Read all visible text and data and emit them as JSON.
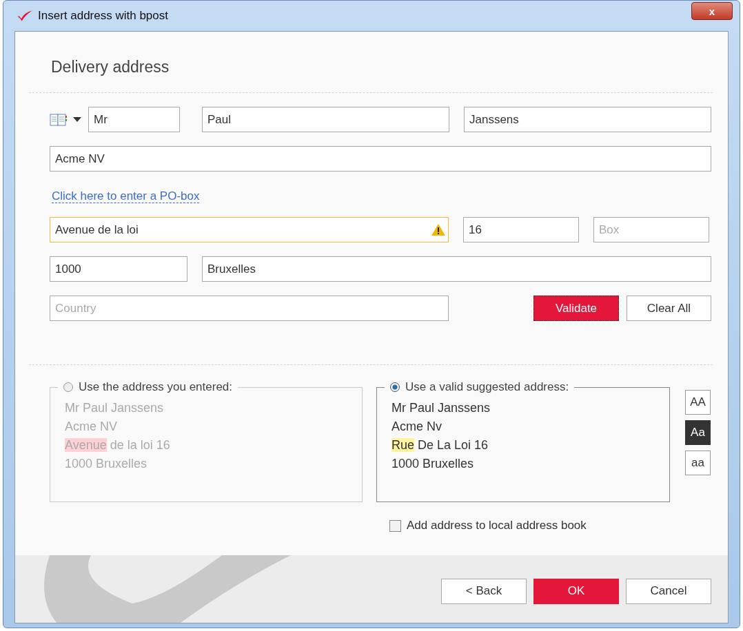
{
  "window": {
    "title": "Insert address with bpost",
    "close": "x"
  },
  "heading": "Delivery address",
  "name_row": [
    {
      "value": "Mr"
    },
    {
      "value": "Paul"
    },
    {
      "value": "Janssens"
    }
  ],
  "company": {
    "value": "Acme NV"
  },
  "po_box_link": "Click here to enter a PO-box",
  "street_row": [
    {
      "value": "Avenue de la loi",
      "warning": true
    },
    {
      "value": "16",
      "warning": false
    },
    {
      "placeholder": "Box",
      "warning": false
    }
  ],
  "city_row": [
    {
      "value": "1000"
    },
    {
      "value": "Bruxelles"
    }
  ],
  "country": {
    "placeholder": "Country"
  },
  "validate_button": "Validate",
  "clear_button": "Clear All",
  "options": [
    {
      "label": "Use the address you entered:",
      "selected": false,
      "lines": [
        [
          {
            "text": "Mr Paul Janssens"
          }
        ],
        [
          {
            "text": "Acme NV"
          }
        ],
        [
          {
            "text": "Avenue",
            "color": "#ffd0d4"
          },
          {
            "text": " de la loi 16"
          }
        ],
        [
          {
            "text": "1000 Bruxelles"
          }
        ]
      ]
    },
    {
      "label": "Use a valid suggested address:",
      "selected": true,
      "lines": [
        [
          {
            "text": "Mr Paul Janssens"
          }
        ],
        [
          {
            "text": "Acme Nv"
          }
        ],
        [
          {
            "text": "Rue",
            "color": "#fff3a0"
          },
          {
            "text": " De La Loi 16"
          }
        ],
        [
          {
            "text": "1000 Bruxelles"
          }
        ]
      ]
    }
  ],
  "case_buttons": [
    {
      "label": "AA",
      "selected": false
    },
    {
      "label": "Aa",
      "selected": true
    },
    {
      "label": "aa",
      "selected": false
    }
  ],
  "add_to_book": {
    "label": "Add address to local address book",
    "checked": false
  },
  "footer_buttons": [
    {
      "label": "< Back",
      "kind": "plain"
    },
    {
      "label": "OK",
      "kind": "primary"
    },
    {
      "label": "Cancel",
      "kind": "plain"
    }
  ]
}
